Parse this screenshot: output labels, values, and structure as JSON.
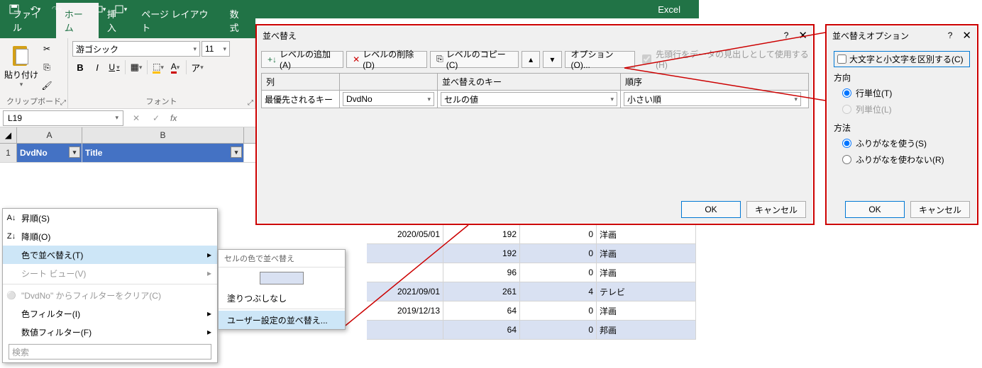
{
  "app": {
    "title": "Excel"
  },
  "qat": {
    "save": "保存",
    "undo": "元に戻す",
    "redo": "やり直し"
  },
  "tabs": {
    "file": "ファイル",
    "home": "ホーム",
    "insert": "挿入",
    "layout": "ページ レイアウト",
    "formula": "数式"
  },
  "ribbon": {
    "paste": "貼り付け",
    "clipboard": "クリップボード",
    "font_name": "游ゴシック",
    "font_size": "11",
    "font_group": "フォント",
    "bold": "B",
    "italic": "I",
    "underline": "U"
  },
  "namebox": "L19",
  "columns": {
    "a": "A",
    "b": "B"
  },
  "headers": {
    "dvdno": "DvdNo",
    "title": "Title"
  },
  "rows": {
    "r1": "1"
  },
  "grid": {
    "r1": {
      "date": "2020/05/01",
      "v1": "192",
      "v2": "0",
      "cat": "洋画"
    },
    "r2": {
      "date": "",
      "v1": "192",
      "v2": "0",
      "cat": "洋画"
    },
    "r3": {
      "date": "",
      "v1": "96",
      "v2": "0",
      "cat": "洋画"
    },
    "r4": {
      "date": "2021/09/01",
      "v1": "261",
      "v2": "4",
      "cat": "テレビ"
    },
    "r5": {
      "date": "2019/12/13",
      "v1": "64",
      "v2": "0",
      "cat": "洋画"
    },
    "r6": {
      "date": "",
      "v1": "64",
      "v2": "0",
      "cat": "邦画"
    }
  },
  "filter": {
    "asc": "昇順(S)",
    "desc": "降順(O)",
    "color_sort": "色で並べ替え(T)",
    "sheet_view": "シート ビュー(V)",
    "clear": "\"DvdNo\" からフィルターをクリア(C)",
    "color_filter": "色フィルター(I)",
    "num_filter": "数値フィルター(F)",
    "search": "検索"
  },
  "submenu": {
    "header": "セルの色で並べ替え",
    "nofill": "塗りつぶしなし",
    "custom": "ユーザー設定の並べ替え..."
  },
  "sort": {
    "title": "並べ替え",
    "add": "レベルの追加(A)",
    "del": "レベルの削除(D)",
    "copy": "レベルのコピー(C)",
    "options": "オプション(O)...",
    "header_check": "先頭行をデータの見出しとして使用する(H)",
    "col": "列",
    "key": "並べ替えのキー",
    "order": "順序",
    "priority": "最優先されるキー",
    "sel_col": "DvdNo",
    "sel_key": "セルの値",
    "sel_order": "小さい順",
    "ok": "OK",
    "cancel": "キャンセル"
  },
  "sortopt": {
    "title": "並べ替えオプション",
    "case": "大文字と小文字を区別する(C)",
    "dir": "方向",
    "rows": "行単位(T)",
    "cols": "列単位(L)",
    "method": "方法",
    "furi1": "ふりがなを使う(S)",
    "furi2": "ふりがなを使わない(R)",
    "ok": "OK",
    "cancel": "キャンセル"
  }
}
